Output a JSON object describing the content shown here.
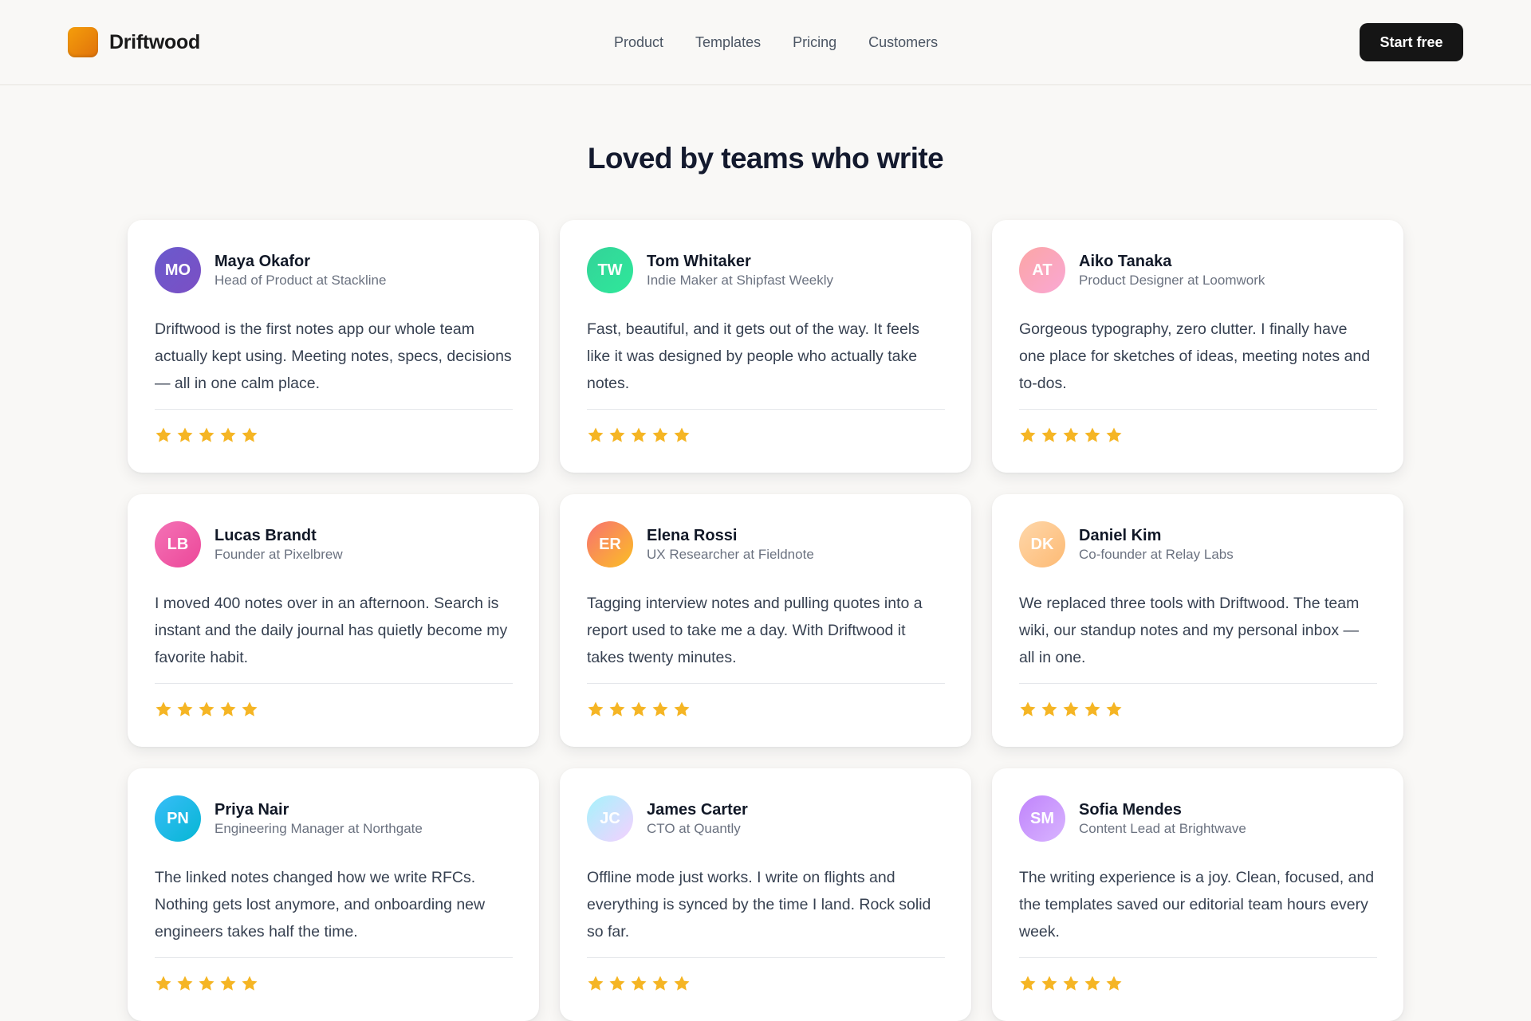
{
  "header": {
    "brand": "Driftwood",
    "nav": [
      "Product",
      "Templates",
      "Pricing",
      "Customers"
    ],
    "cta_label": "Start free"
  },
  "section": {
    "title": "Loved by teams who write"
  },
  "colors": {
    "star": "#f5b524",
    "cta_bg": "#151515",
    "logo": "#f59e0b"
  },
  "testimonials": [
    {
      "initials": "MO",
      "name": "Maya Okafor",
      "role": "Head of Product at Stackline",
      "quote": "Driftwood is the first notes app our whole team actually kept using. Meeting notes, specs, decisions — all in one calm place.",
      "rating": 5,
      "avatar_colors": [
        "#6a5acd",
        "#7b4fc4"
      ]
    },
    {
      "initials": "TW",
      "name": "Tom Whitaker",
      "role": "Indie Maker at Shipfast Weekly",
      "quote": "Fast, beautiful, and it gets out of the way. It feels like it was designed by people who actually take notes.",
      "rating": 5,
      "avatar_colors": [
        "#34d399",
        "#2ee89a"
      ]
    },
    {
      "initials": "AT",
      "name": "Aiko Tanaka",
      "role": "Product Designer at Loomwork",
      "quote": "Gorgeous typography, zero clutter. I finally have one place for sketches of ideas, meeting notes and to-dos.",
      "rating": 5,
      "avatar_colors": [
        "#fca5a5",
        "#f9a8d4"
      ]
    },
    {
      "initials": "LB",
      "name": "Lucas Brandt",
      "role": "Founder at Pixelbrew",
      "quote": "I moved 400 notes over in an afternoon. Search is instant and the daily journal has quietly become my favorite habit.",
      "rating": 5,
      "avatar_colors": [
        "#f472b6",
        "#ec4899"
      ]
    },
    {
      "initials": "ER",
      "name": "Elena Rossi",
      "role": "UX Researcher at Fieldnote",
      "quote": "Tagging interview notes and pulling quotes into a report used to take me a day. With Driftwood it takes twenty minutes.",
      "rating": 5,
      "avatar_colors": [
        "#f87171",
        "#fbbf24"
      ]
    },
    {
      "initials": "DK",
      "name": "Daniel Kim",
      "role": "Co-founder at Relay Labs",
      "quote": "We replaced three tools with Driftwood. The team wiki, our standup notes and my personal inbox — all in one.",
      "rating": 5,
      "avatar_colors": [
        "#fed7aa",
        "#fdba74"
      ]
    },
    {
      "initials": "PN",
      "name": "Priya Nair",
      "role": "Engineering Manager at Northgate",
      "quote": "The linked notes changed how we write RFCs. Nothing gets lost anymore, and onboarding new engineers takes half the time.",
      "rating": 5,
      "avatar_colors": [
        "#38bdf8",
        "#06b6d4"
      ]
    },
    {
      "initials": "JC",
      "name": "James Carter",
      "role": "CTO at Quantly",
      "quote": "Offline mode just works. I write on flights and everything is synced by the time I land. Rock solid so far.",
      "rating": 5,
      "avatar_colors": [
        "#a5f3fc",
        "#f5d0fe"
      ]
    },
    {
      "initials": "SM",
      "name": "Sofia Mendes",
      "role": "Content Lead at Brightwave",
      "quote": "The writing experience is a joy. Clean, focused, and the templates saved our editorial team hours every week.",
      "rating": 5,
      "avatar_colors": [
        "#c084fc",
        "#d8b4fe"
      ]
    }
  ]
}
